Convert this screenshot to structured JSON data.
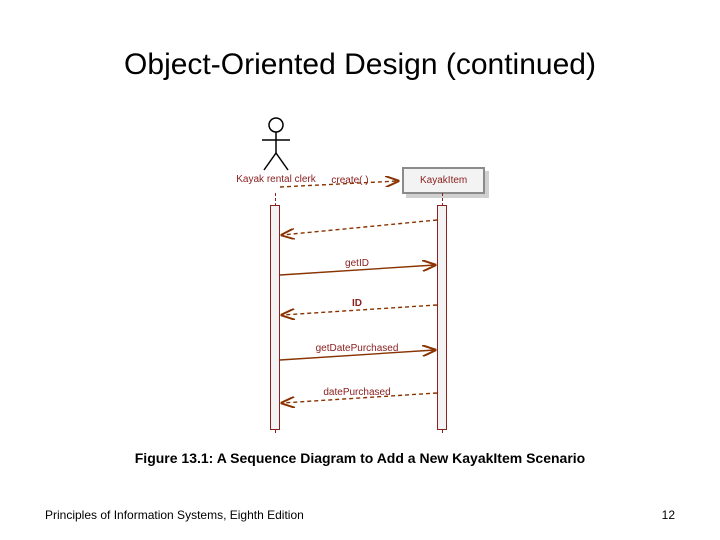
{
  "slide": {
    "title": "Object-Oriented Design (continued)",
    "caption": "Figure 13.1: A Sequence Diagram to Add a New KayakItem Scenario",
    "footer_left": "Principles of Information Systems, Eighth Edition",
    "page_number": "12"
  },
  "diagram": {
    "actor_label": "Kayak rental clerk",
    "object_label": "KayakItem",
    "messages": {
      "create": "create( )",
      "getID": "getID",
      "ID": "ID",
      "getDatePurchased": "getDatePurchased",
      "datePurchased": "datePurchased"
    }
  }
}
